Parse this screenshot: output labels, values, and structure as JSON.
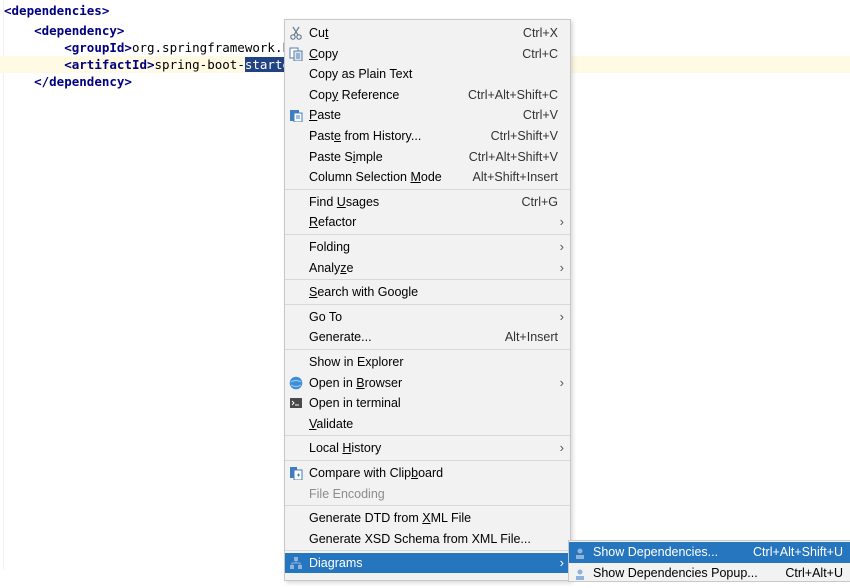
{
  "editor": {
    "lines": [
      {
        "indent": "",
        "open": "<dependencies>",
        "text": "",
        "close": ""
      },
      {
        "indent": "    ",
        "open": "<dependency>",
        "text": "",
        "close": ""
      },
      {
        "indent": "        ",
        "open": "<groupId>",
        "text": "org.springframework.b",
        "close": ""
      },
      {
        "indent": "        ",
        "open": "<artifactId>",
        "text": "spring-boot-",
        "selected": "starte"
      },
      {
        "indent": "    ",
        "open": "</dependency>",
        "text": "",
        "close": ""
      }
    ]
  },
  "context_menu": {
    "items": [
      {
        "label": "Cut",
        "u": "t",
        "shortcut": "Ctrl+X",
        "icon": "scissors-icon"
      },
      {
        "label": "Copy",
        "u": "C",
        "shortcut": "Ctrl+C",
        "icon": "copy-icon"
      },
      {
        "label": "Copy as Plain Text",
        "shortcut": ""
      },
      {
        "label": "Copy Reference",
        "u": "y",
        "shortcut": "Ctrl+Alt+Shift+C"
      },
      {
        "label": "Paste",
        "u": "P",
        "shortcut": "Ctrl+V",
        "icon": "paste-icon"
      },
      {
        "label": "Paste from History...",
        "u": "e",
        "shortcut": "Ctrl+Shift+V"
      },
      {
        "label": "Paste Simple",
        "u": "i",
        "shortcut": "Ctrl+Alt+Shift+V"
      },
      {
        "label": "Column Selection Mode",
        "u": "M",
        "shortcut": "Alt+Shift+Insert"
      },
      {
        "sep": true
      },
      {
        "label": "Find Usages",
        "u": "U",
        "shortcut": "Ctrl+G"
      },
      {
        "label": "Refactor",
        "u": "R",
        "submenu": true
      },
      {
        "sep": true
      },
      {
        "label": "Folding",
        "submenu": true
      },
      {
        "label": "Analyze",
        "u": "z",
        "submenu": true
      },
      {
        "sep": true
      },
      {
        "label": "Search with Google",
        "u": "S"
      },
      {
        "sep": true
      },
      {
        "label": "Go To",
        "submenu": true
      },
      {
        "label": "Generate...",
        "shortcut": "Alt+Insert"
      },
      {
        "sep": true
      },
      {
        "label": "Show in Explorer"
      },
      {
        "label": "Open in Browser",
        "u": "B",
        "submenu": true,
        "icon": "globe-icon"
      },
      {
        "label": "Open in terminal",
        "icon": "terminal-icon"
      },
      {
        "label": "Validate",
        "u": "V"
      },
      {
        "sep": true
      },
      {
        "label": "Local History",
        "u": "H",
        "submenu": true
      },
      {
        "sep": true
      },
      {
        "label": "Compare with Clipboard",
        "u": "b",
        "icon": "compare-icon"
      },
      {
        "label": "File Encoding",
        "disabled": true
      },
      {
        "sep": true
      },
      {
        "label": "Generate DTD from XML File",
        "u": "X"
      },
      {
        "label": "Generate XSD Schema from XML File..."
      },
      {
        "sep": true
      },
      {
        "label": "Diagrams",
        "submenu": true,
        "active": true,
        "icon": "diagram-icon"
      }
    ]
  },
  "submenu": {
    "items": [
      {
        "label": "Show Dependencies...",
        "shortcut": "Ctrl+Alt+Shift+U",
        "active": true
      },
      {
        "label": "Show Dependencies Popup...",
        "shortcut": "Ctrl+Alt+U"
      }
    ]
  },
  "colors": {
    "selection": "#2675bf",
    "tag": "#000080",
    "caret_line": "#fffae3"
  }
}
